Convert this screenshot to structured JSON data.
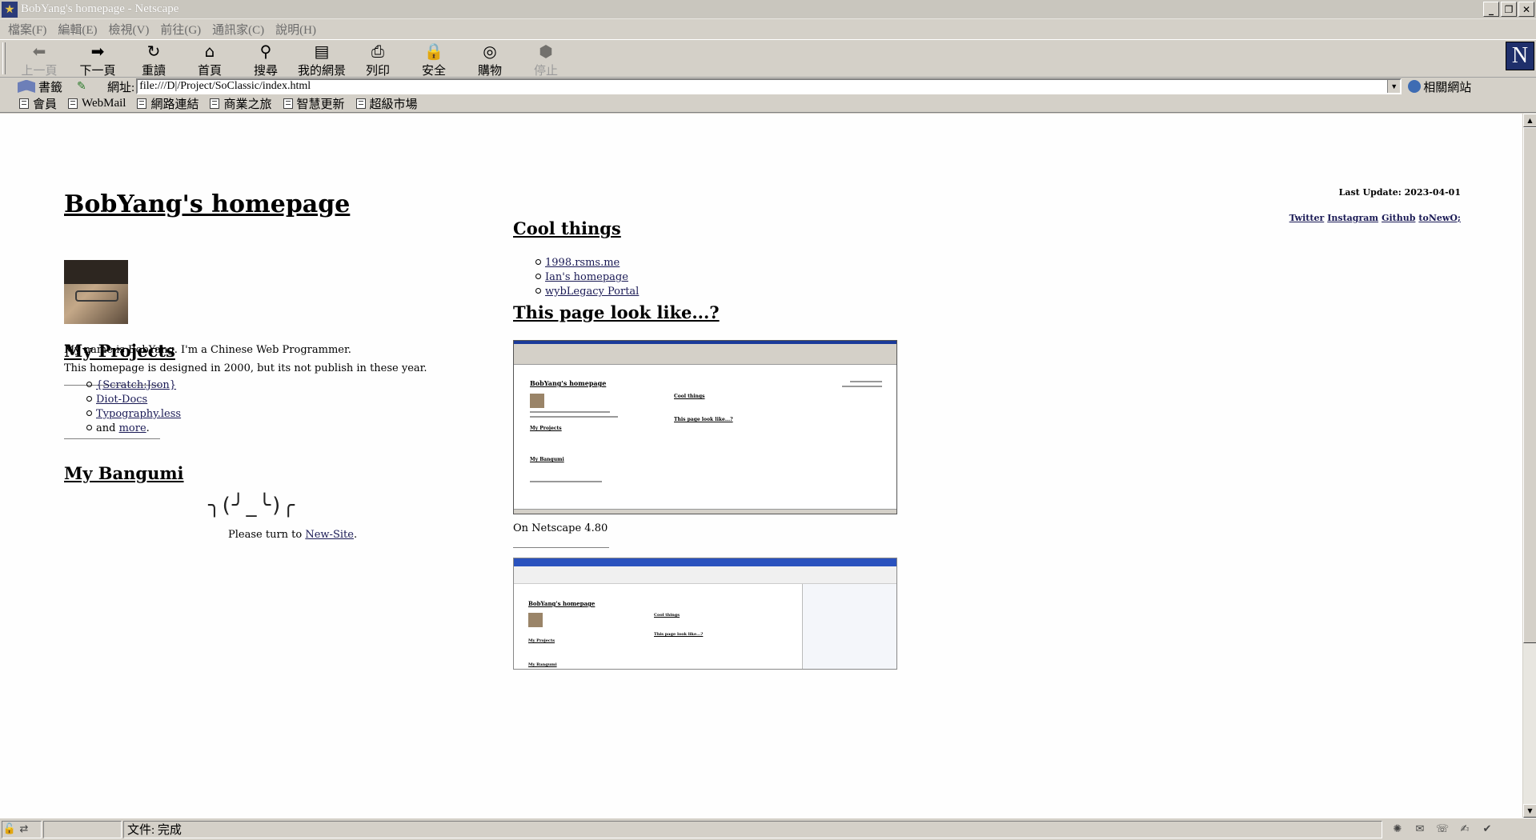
{
  "window": {
    "title": "BobYang's homepage - Netscape",
    "controls": {
      "minimize": "_",
      "restore": "❐",
      "close": "✕"
    }
  },
  "menu": [
    "檔案(F)",
    "編輯(E)",
    "檢視(V)",
    "前往(G)",
    "通訊家(C)",
    "說明(H)"
  ],
  "toolbar": [
    {
      "label": "上一頁",
      "icon": "back-arrow-icon",
      "glyph": "⬅",
      "disabled": true
    },
    {
      "label": "下一頁",
      "icon": "forward-arrow-icon",
      "glyph": "➡",
      "disabled": false
    },
    {
      "label": "重讀",
      "icon": "reload-icon",
      "glyph": "↻",
      "disabled": false
    },
    {
      "label": "首頁",
      "icon": "home-icon",
      "glyph": "⌂",
      "disabled": false
    },
    {
      "label": "搜尋",
      "icon": "search-icon",
      "glyph": "⚲",
      "disabled": false
    },
    {
      "label": "我的網景",
      "icon": "my-netscape-icon",
      "glyph": "▤",
      "disabled": false
    },
    {
      "label": "列印",
      "icon": "print-icon",
      "glyph": "⎙",
      "disabled": false
    },
    {
      "label": "安全",
      "icon": "lock-icon",
      "glyph": "🔒",
      "disabled": false
    },
    {
      "label": "購物",
      "icon": "shopping-icon",
      "glyph": "◎",
      "disabled": false
    },
    {
      "label": "停止",
      "icon": "stop-icon",
      "glyph": "⬢",
      "disabled": true
    }
  ],
  "logo_letter": "N",
  "location": {
    "bookmarks_label": "書籤",
    "address_label": "網址:",
    "url": "file:///D|/Project/SoClassic/index.html",
    "related_label": "相關網站"
  },
  "personal_toolbar": [
    "會員",
    "WebMail",
    "網路連結",
    "商業之旅",
    "智慧更新",
    "超級市場"
  ],
  "page": {
    "title": "BobYang's homepage",
    "last_update": "Last Update: 2023-04-01",
    "social": [
      "Twitter",
      "Instagram",
      "Github",
      "toNewO;"
    ],
    "intro_1": "My name is BobYang. I'm a Chinese Web Programmer.",
    "intro_2": "This homepage is designed in 2000, but its not publish in these year.",
    "projects_title": "My Projects",
    "projects": [
      "{Scratch:Json}",
      "Diot-Docs",
      "Typography.less"
    ],
    "projects_more_prefix": "and ",
    "projects_more_link": "more",
    "projects_more_suffix": ".",
    "bangumi_title": "My Bangumi",
    "kaomoji": "╮(╯_╰)╭",
    "turn_prefix": "Please turn to ",
    "turn_link": "New-Site",
    "turn_suffix": ".",
    "cool_title": "Cool things",
    "cool": [
      "1998.rsms.me",
      "Ian's homepage",
      "wybLegacy Portal"
    ],
    "looklike_title": "This page look like...?",
    "caption_1": "On Netscape 4.80",
    "mini_title": "BobYang's homepage",
    "mini_cool": "Cool things",
    "mini_looklike": "This page look like...?",
    "mini_projects": "My Projects",
    "mini_bangumi": "My Bangumi"
  },
  "status": {
    "text": "文件: 完成"
  }
}
